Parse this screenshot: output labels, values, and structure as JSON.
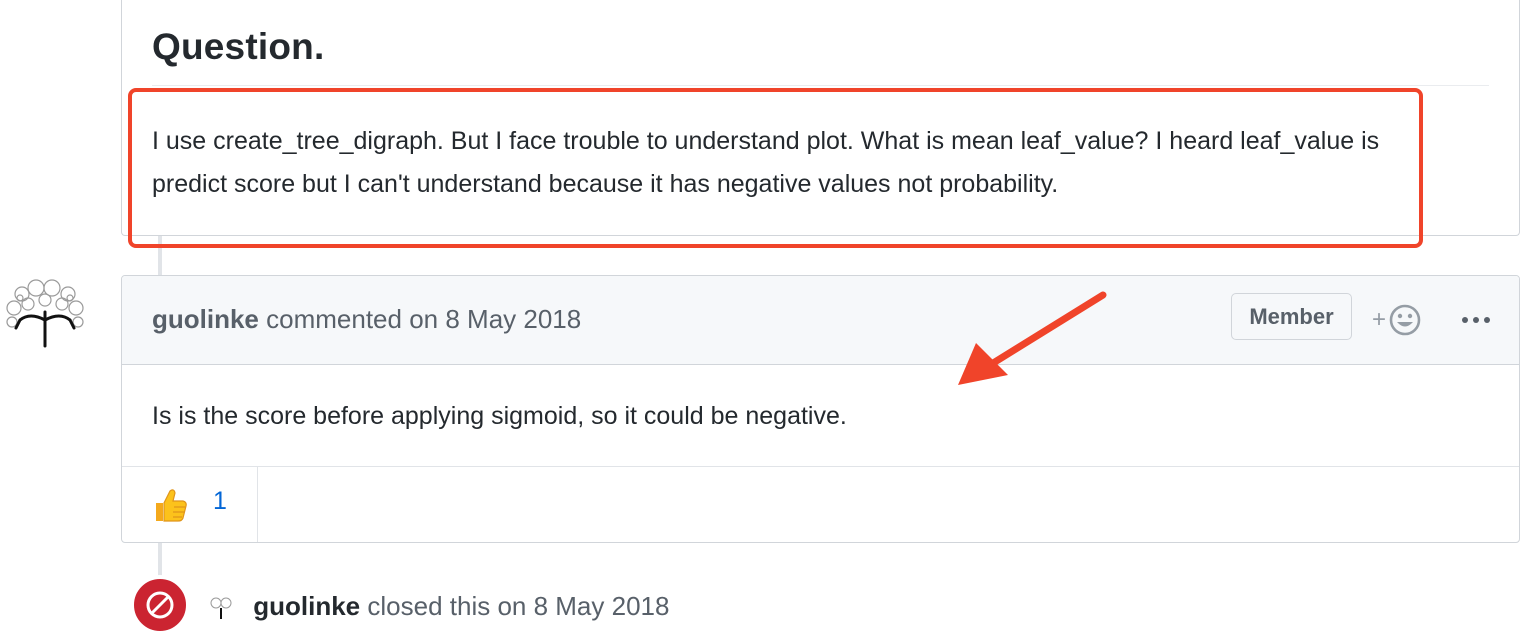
{
  "previous_comment": {
    "heading": "Question.",
    "text": "I use create_tree_digraph. But I face trouble to understand plot. What is mean leaf_value? I heard leaf_value is predict score but I can't understand because it has negative values not probability."
  },
  "comment": {
    "author": "guolinke",
    "action": "commented on 8 May 2018",
    "role_badge": "Member",
    "body": "Is is the score before applying sigmoid, so it could be negative.",
    "reactions": [
      {
        "icon": "thumbs-up-icon",
        "count": "1"
      }
    ]
  },
  "closed_event": {
    "author": "guolinke",
    "text": "closed this on 8 May 2018"
  },
  "colors": {
    "annotation_red": "#f0442a",
    "closed_red": "#cb2431",
    "link_blue": "#0366d6"
  }
}
